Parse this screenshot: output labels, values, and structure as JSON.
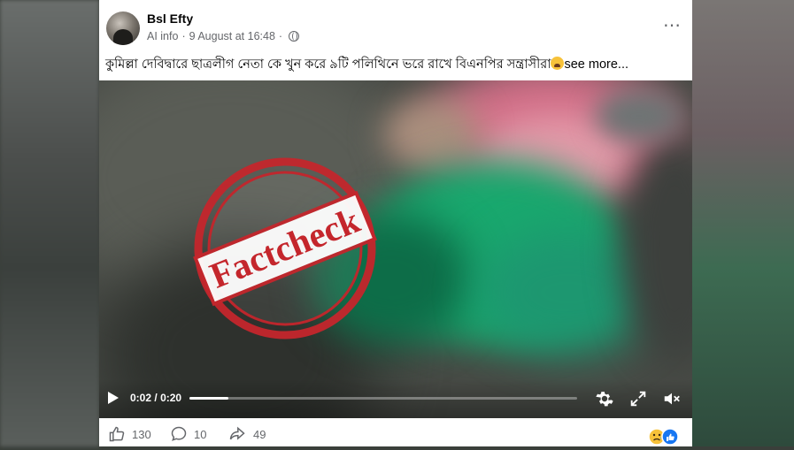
{
  "post": {
    "author": "Bsl Efty",
    "ai_info": "AI info",
    "date_sep": "·",
    "date": "9 August at 16:48",
    "more_icon": "⋯",
    "caption": "কুমিল্লা দেবিদ্বারে ছাত্রলীগ নেতা কে খুন করে ৯টি পলিথিনে ভরে রাখে বিএনপির সন্ত্রাসীরা",
    "caption_emoji": "crying-face-emoji",
    "see_more": "see more..."
  },
  "video": {
    "stamp_text": "Factcheck",
    "current_time": "0:02",
    "separator": "/",
    "duration": "0:20",
    "progress": 0.1,
    "icons": [
      "play-icon",
      "settings-icon",
      "fullscreen-icon",
      "mute-icon"
    ]
  },
  "engagement": {
    "likes": "130",
    "comments": "10",
    "shares": "49",
    "reaction_icons": [
      "sad-reaction-icon",
      "like-reaction-icon"
    ]
  },
  "colors": {
    "stamp_red": "#c4262c",
    "facebook_blue": "#1877f2",
    "meta_gray": "#65676b"
  }
}
